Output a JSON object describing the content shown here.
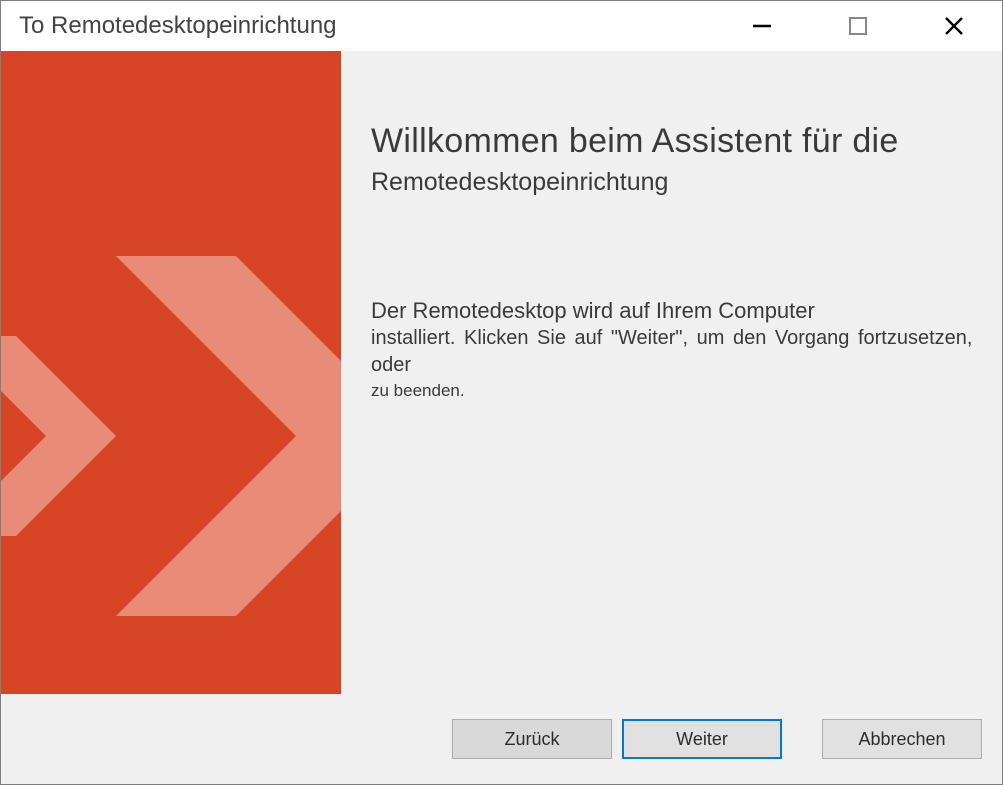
{
  "titlebar": {
    "title": "To Remotedesktopeinrichtung"
  },
  "main": {
    "headline": "Willkommen beim Assistent für die",
    "subheadline": "Remotedesktopeinrichtung",
    "body_lead": "Der Remotedesktop wird auf Ihrem Computer",
    "body_text": "installiert. Klicken Sie auf \"Weiter\", um den Vorgang fortzusetzen, oder",
    "body_tail": "zu beenden."
  },
  "footer": {
    "back": "Zurück",
    "next": "Weiter",
    "cancel": "Abbrechen"
  },
  "colors": {
    "accent": "#d74425"
  }
}
